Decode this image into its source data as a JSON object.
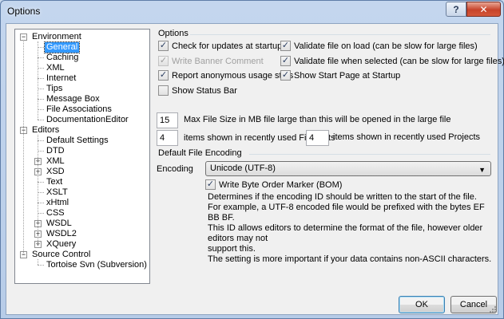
{
  "window": {
    "title": "Options"
  },
  "titlebar": {
    "help": "?",
    "close": "✕"
  },
  "tree": {
    "items": [
      {
        "label": "Environment",
        "level": 0,
        "expander": "−"
      },
      {
        "label": "General",
        "level": 1,
        "selected": true
      },
      {
        "label": "Caching",
        "level": 1
      },
      {
        "label": "XML",
        "level": 1
      },
      {
        "label": "Internet",
        "level": 1
      },
      {
        "label": "Tips",
        "level": 1
      },
      {
        "label": "Message Box",
        "level": 1
      },
      {
        "label": "File Associations",
        "level": 1
      },
      {
        "label": "DocumentationEditor",
        "level": 1
      },
      {
        "label": "Editors",
        "level": 0,
        "expander": "−"
      },
      {
        "label": "Default Settings",
        "level": 1
      },
      {
        "label": "DTD",
        "level": 1
      },
      {
        "label": "XML",
        "level": 1,
        "expander": "+"
      },
      {
        "label": "XSD",
        "level": 1,
        "expander": "+"
      },
      {
        "label": "Text",
        "level": 1
      },
      {
        "label": "XSLT",
        "level": 1
      },
      {
        "label": "xHtml",
        "level": 1
      },
      {
        "label": "CSS",
        "level": 1
      },
      {
        "label": "WSDL",
        "level": 1,
        "expander": "+"
      },
      {
        "label": "WSDL2",
        "level": 1,
        "expander": "+"
      },
      {
        "label": "XQuery",
        "level": 1,
        "expander": "+"
      },
      {
        "label": "Source Control",
        "level": 0,
        "expander": "−"
      },
      {
        "label": "Tortoise Svn (Subversion)",
        "level": 1
      }
    ]
  },
  "options": {
    "group_title": "Options",
    "check_updates": "Check for updates at startup",
    "write_banner": "Write Banner Comment",
    "anonymous_stats": "Report anonymous usage stats",
    "show_status_bar": "Show Status Bar",
    "validate_on_load": "Validate file on load (can be slow for large files)",
    "validate_when_selected": "Validate file when selected (can be slow for large files)",
    "show_start_page": "Show Start Page at Startup",
    "max_file_size_value": "15",
    "max_file_size_label": "Max File Size in MB file large than this will be opened in the large file",
    "recent_files_value": "4",
    "recent_files_label": "items shown in recently used Files lists",
    "recent_projects_value": "4",
    "recent_projects_label": "items shown in recently used Projects"
  },
  "encoding": {
    "group_title": "Default File Encoding",
    "label": "Encoding",
    "selected": "Unicode (UTF-8)",
    "bom_label": "Write Byte Order Marker (BOM)",
    "desc_1": "Determines if the encoding ID should be written to the start of the file.",
    "desc_2": "For example, a UTF-8 encoded file would be prefixed with the bytes EF BB BF.",
    "desc_3": "This ID allows editors to determine the format of the file, however older editors may not",
    "desc_4": "support this.",
    "desc_5": "The setting is more important if your data contains non-ASCII characters."
  },
  "buttons": {
    "ok": "OK",
    "cancel": "Cancel"
  },
  "checks": {
    "mark": "✓"
  }
}
